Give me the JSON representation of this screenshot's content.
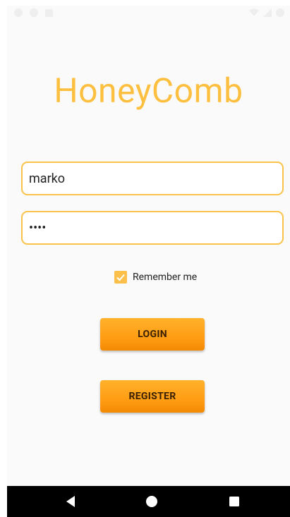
{
  "app": {
    "title": "HoneyComb"
  },
  "form": {
    "username_value": "marko",
    "password_value": "••••",
    "remember_label": "Remember me",
    "remember_checked": true
  },
  "buttons": {
    "login_label": "LOGIN",
    "register_label": "REGISTER"
  },
  "colors": {
    "accent": "#fdbf3f",
    "button": "#ff9d14",
    "nav_bar": "#000000"
  },
  "icons": {
    "status_left": [
      "settings-icon",
      "circle-icon",
      "sd-card-icon"
    ],
    "status_right": [
      "wifi-icon",
      "signal-icon",
      "battery-icon"
    ],
    "nav": [
      "back-icon",
      "home-icon",
      "recents-icon"
    ]
  }
}
